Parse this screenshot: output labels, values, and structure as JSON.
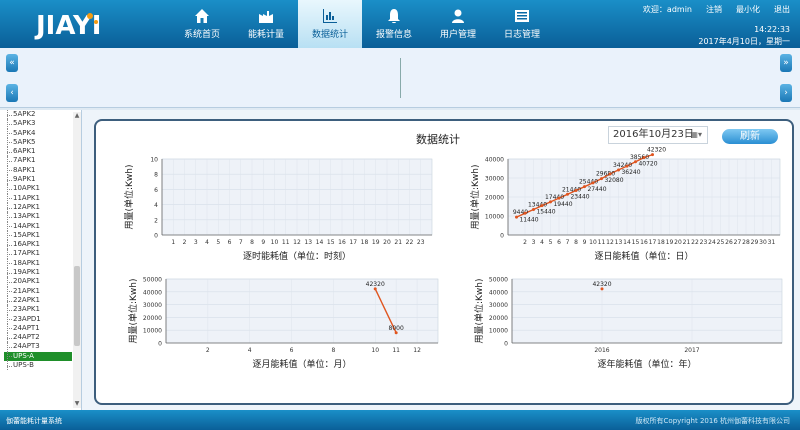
{
  "header": {
    "logo_text": "JIAYI",
    "nav": [
      {
        "label": "系统首页",
        "icon": "home-icon"
      },
      {
        "label": "能耗计量",
        "icon": "factory-icon"
      },
      {
        "label": "数据统计",
        "icon": "bar-chart-icon",
        "active": true
      },
      {
        "label": "报警信息",
        "icon": "alarm-bell-icon"
      },
      {
        "label": "用户管理",
        "icon": "user-icon"
      },
      {
        "label": "日志管理",
        "icon": "list-icon"
      }
    ],
    "welcome": "欢迎：admin",
    "logout": "注销",
    "minimize": "最小化",
    "exit": "退出",
    "time": "14:22:33",
    "date": "2017年4月10日，星期一"
  },
  "sidebar": {
    "items": [
      "5APK2",
      "5APK3",
      "5APK4",
      "5APK5",
      "6APK1",
      "7APK1",
      "8APK1",
      "9APK1",
      "10APK1",
      "11APK1",
      "12APK1",
      "13APK1",
      "14APK1",
      "15APK1",
      "16APK1",
      "17APK1",
      "18APK1",
      "19APK1",
      "20APK1",
      "21APK1",
      "22APK1",
      "23APK1",
      "23APD1",
      "24APT1",
      "24APT2",
      "24APT3",
      "UPS-A",
      "UPS-B"
    ],
    "selected": "UPS-A"
  },
  "main": {
    "title": "数据统计",
    "date_value": "2016年10月23日",
    "refresh_label": "刷新"
  },
  "colors": {
    "line": "#e0551f",
    "accent": "#1a8fc8",
    "plot_bg": "#eef2f8"
  },
  "chart_data": [
    {
      "type": "line",
      "xlabel": "逐时能耗值（单位：时刻）",
      "ylabel": "用量(单位:Kwh)",
      "x": [
        1,
        2,
        3,
        4,
        5,
        6,
        7,
        8,
        9,
        10,
        11,
        12,
        13,
        14,
        15,
        16,
        17,
        18,
        19,
        20,
        21,
        22,
        23
      ],
      "ylim": [
        0,
        10
      ],
      "yticks": [
        0,
        2,
        4,
        6,
        8,
        10
      ],
      "points": []
    },
    {
      "type": "line",
      "xlabel": "逐日能耗值（单位：日）",
      "ylabel": "用量(单位:Kwh)",
      "x": [
        2,
        3,
        4,
        5,
        6,
        7,
        8,
        9,
        10,
        11,
        12,
        13,
        14,
        15,
        16,
        17,
        18,
        19,
        20,
        21,
        22,
        23,
        24,
        25,
        26,
        27,
        28,
        29,
        30,
        31
      ],
      "ylim": [
        0,
        40000
      ],
      "yticks": [
        0,
        10000,
        20000,
        30000,
        40000
      ],
      "points": [
        [
          1,
          9440
        ],
        [
          2,
          11440
        ],
        [
          3,
          13440
        ],
        [
          4,
          15440
        ],
        [
          5,
          17440
        ],
        [
          6,
          19440
        ],
        [
          7,
          21440
        ],
        [
          8,
          23440
        ],
        [
          9,
          25440
        ],
        [
          10,
          27440
        ],
        [
          11,
          29680
        ],
        [
          12,
          32080
        ],
        [
          13,
          34240
        ],
        [
          14,
          36240
        ],
        [
          15,
          38560
        ],
        [
          16,
          40720
        ],
        [
          17,
          42320
        ]
      ]
    },
    {
      "type": "line",
      "xlabel": "逐月能耗值（单位：月）",
      "ylabel": "用量(单位:Kwh)",
      "x": [
        2,
        4,
        6,
        8,
        10,
        11,
        12
      ],
      "ylim": [
        0,
        50000
      ],
      "yticks": [
        0,
        10000,
        20000,
        30000,
        40000,
        50000
      ],
      "points": [
        [
          10,
          42320
        ],
        [
          11,
          8000
        ]
      ]
    },
    {
      "type": "line",
      "xlabel": "逐年能耗值（单位：年）",
      "ylabel": "用量(单位:Kwh)",
      "x": [
        2016,
        2017
      ],
      "ylim": [
        0,
        50000
      ],
      "yticks": [
        0,
        10000,
        20000,
        30000,
        40000,
        50000
      ],
      "points": [
        [
          2016,
          42320
        ]
      ]
    }
  ],
  "footer": {
    "left": "伽蕾能耗计量系统",
    "right": "版权所有Copyright 2016 杭州伽蕾科技有限公司"
  }
}
